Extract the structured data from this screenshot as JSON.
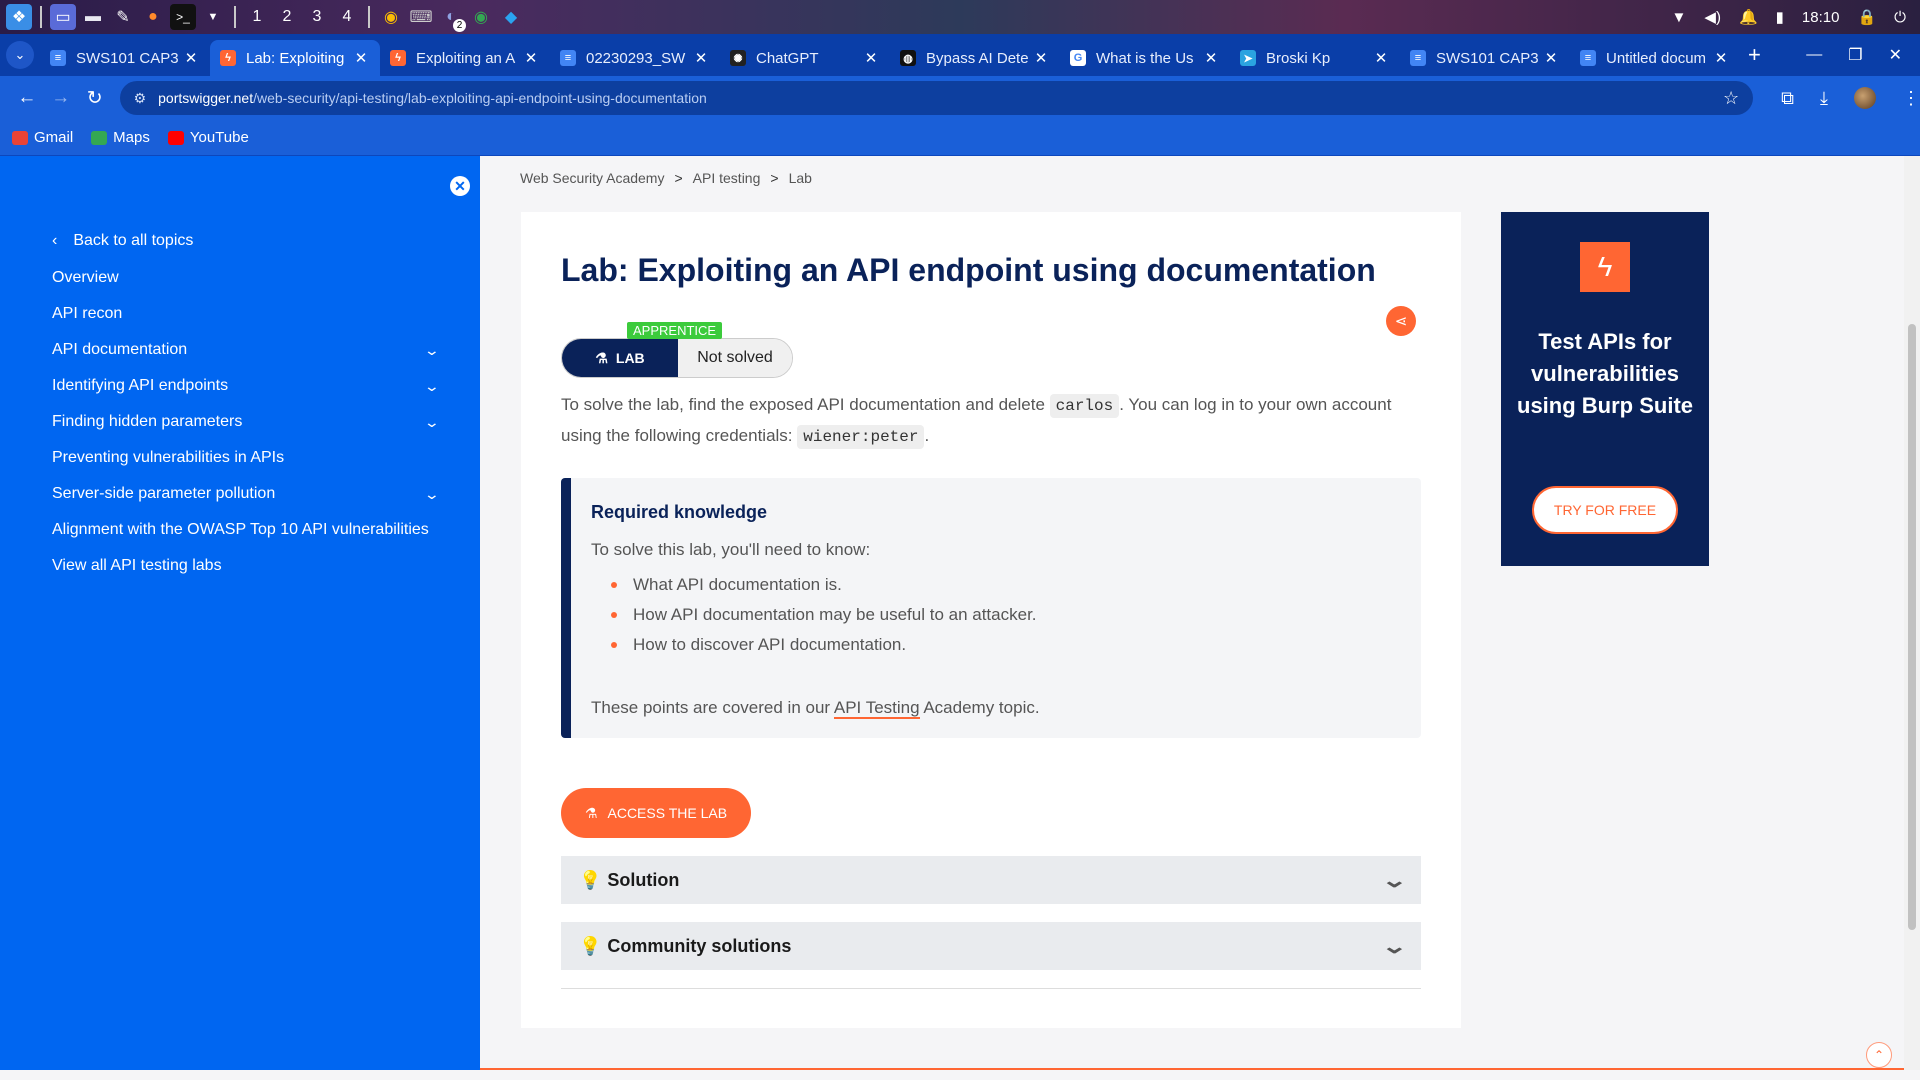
{
  "taskbar": {
    "workspaces": [
      "1",
      "2",
      "3",
      "4"
    ],
    "clock": "18:10",
    "badge_count": "2"
  },
  "tabs": [
    {
      "title": "SWS101 CAP3",
      "icon": "docs-icon",
      "color": "#4285f4",
      "active": false
    },
    {
      "title": "Lab: Exploiting",
      "icon": "portswigger-icon",
      "color": "#ff6633",
      "active": true
    },
    {
      "title": "Exploiting an A",
      "icon": "portswigger-icon",
      "color": "#ff6633",
      "active": false
    },
    {
      "title": "02230293_SW",
      "icon": "docs-icon",
      "color": "#4285f4",
      "active": false
    },
    {
      "title": "ChatGPT",
      "icon": "chatgpt-icon",
      "color": "#222222",
      "active": false
    },
    {
      "title": "Bypass AI Dete",
      "icon": "globe-icon",
      "color": "#111111",
      "active": false
    },
    {
      "title": "What is the Us",
      "icon": "google-icon",
      "color": "#ffffff",
      "active": false
    },
    {
      "title": "Broski Kp",
      "icon": "telegram-icon",
      "color": "#2aa3e0",
      "active": false
    },
    {
      "title": "SWS101 CAP3",
      "icon": "docs-icon",
      "color": "#4285f4",
      "active": false
    },
    {
      "title": "Untitled docum",
      "icon": "docs-icon",
      "color": "#4285f4",
      "active": false
    }
  ],
  "address": {
    "host": "portswigger.net",
    "path": "/web-security/api-testing/lab-exploiting-api-endpoint-using-documentation"
  },
  "bookmarks": [
    {
      "label": "Gmail",
      "color": "#ea4335"
    },
    {
      "label": "Maps",
      "color": "#34a853"
    },
    {
      "label": "YouTube",
      "color": "#ff0000"
    }
  ],
  "sidebar": {
    "back_label": "Back to all topics",
    "items": [
      {
        "label": "Overview",
        "expandable": false
      },
      {
        "label": "API recon",
        "expandable": false
      },
      {
        "label": "API documentation",
        "expandable": true
      },
      {
        "label": "Identifying API endpoints",
        "expandable": true
      },
      {
        "label": "Finding hidden parameters",
        "expandable": true
      },
      {
        "label": "Preventing vulnerabilities in APIs",
        "expandable": false
      },
      {
        "label": "Server-side parameter pollution",
        "expandable": true
      },
      {
        "label": "Alignment with the OWASP Top 10 API vulnerabilities",
        "expandable": false
      },
      {
        "label": "View all API testing labs",
        "expandable": false
      }
    ]
  },
  "breadcrumb": [
    "Web Security Academy",
    "API testing",
    "Lab"
  ],
  "breadcrumb_sep": ">",
  "lab": {
    "title": "Lab: Exploiting an API endpoint using documentation",
    "level": "APPRENTICE",
    "type_label": "LAB",
    "status": "Not solved",
    "intro_1": "To solve the lab, find the exposed API documentation and delete ",
    "intro_code_1": "carlos",
    "intro_2": ". You can log in to your own account using the following credentials: ",
    "intro_code_2": "wiener:peter",
    "intro_3": "."
  },
  "knowledge": {
    "title": "Required knowledge",
    "lead": "To solve this lab, you'll need to know:",
    "points": [
      "What API documentation is.",
      "How API documentation may be useful to an attacker.",
      "How to discover API documentation."
    ],
    "foot_1": "These points are covered in our ",
    "foot_link": "API Testing",
    "foot_2": " Academy topic."
  },
  "access_label": "ACCESS THE LAB",
  "accordions": {
    "solution": "Solution",
    "community": "Community solutions"
  },
  "promo": {
    "text": "Test APIs for vulnerabilities using Burp Suite",
    "button": "TRY FOR FREE"
  },
  "colors": {
    "accent": "#ff6633",
    "navy": "#0a2259",
    "sidebar": "#0066f1",
    "apprentice": "#3ccb3c"
  }
}
